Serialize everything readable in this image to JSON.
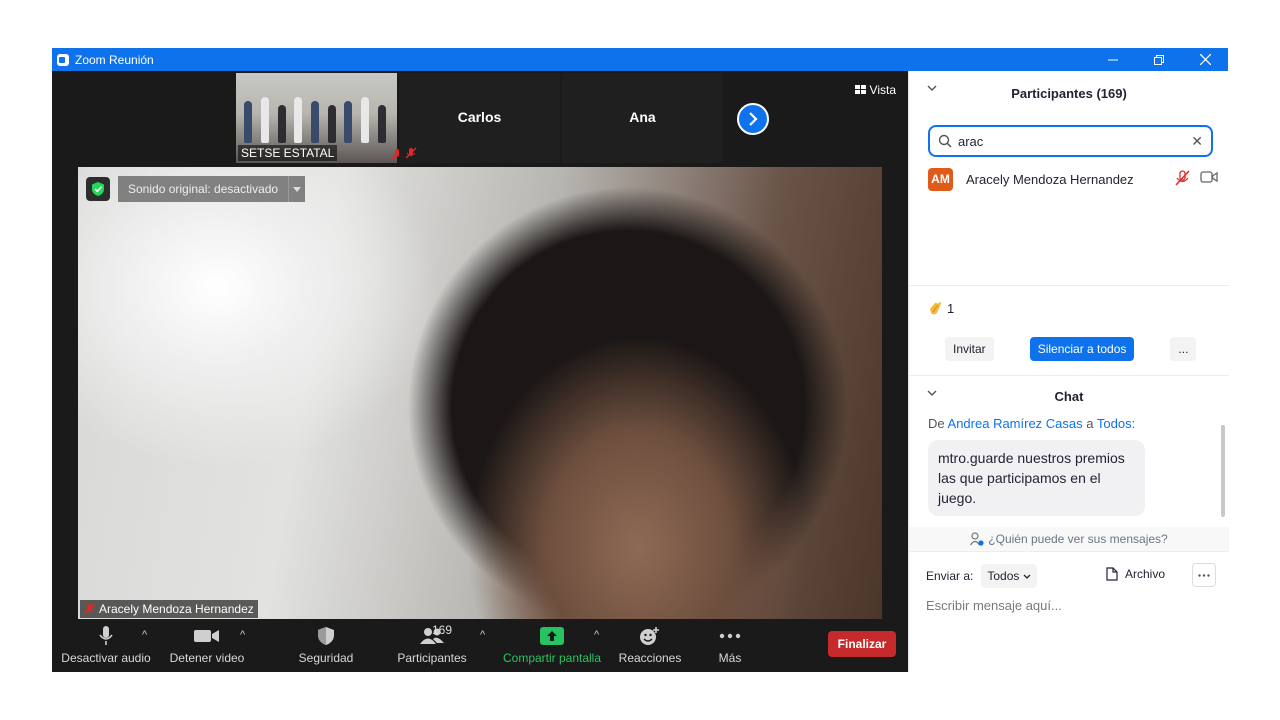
{
  "window": {
    "title": "Zoom Reunión"
  },
  "gallery": {
    "tiles": [
      {
        "label": "SETSE ESTATAL"
      },
      {
        "name": "Carlos"
      },
      {
        "name": "Ana"
      }
    ],
    "view_label": "Vista"
  },
  "video": {
    "sound_label": "Sonido original: desactivado",
    "speaker_name": "Aracely Mendoza Hernandez"
  },
  "toolbar": {
    "audio_label": "Desactivar audio",
    "video_label": "Detener video",
    "security_label": "Seguridad",
    "participants_label": "Participantes",
    "participants_count": "169",
    "share_label": "Compartir pantalla",
    "reactions_label": "Reacciones",
    "more_label": "Más",
    "end_label": "Finalizar"
  },
  "participants_panel": {
    "title": "Participantes (169)",
    "search_value": "arac",
    "results": [
      {
        "initials": "AM",
        "name": "Aracely Mendoza Hernandez"
      }
    ],
    "reaction_count": "1",
    "invite_label": "Invitar",
    "mute_all_label": "Silenciar a todos",
    "more_label": "..."
  },
  "chat_panel": {
    "title": "Chat",
    "from_prefix": "De",
    "from_name": "Andrea Ramírez Casas",
    "to_word": "a",
    "to_name": "Todos:",
    "message": "mtro.guarde nuestros premios las que participamos en el juego.",
    "privacy_text": "¿Quién puede ver sus mensajes?",
    "send_to_label": "Enviar a:",
    "send_to_value": "Todos",
    "file_label": "Archivo",
    "input_placeholder": "Escribir mensaje aquí..."
  },
  "colors": {
    "accent": "#0e72ed",
    "end": "#c72a2a",
    "share": "#29c263",
    "avatar": "#e05a1a"
  }
}
